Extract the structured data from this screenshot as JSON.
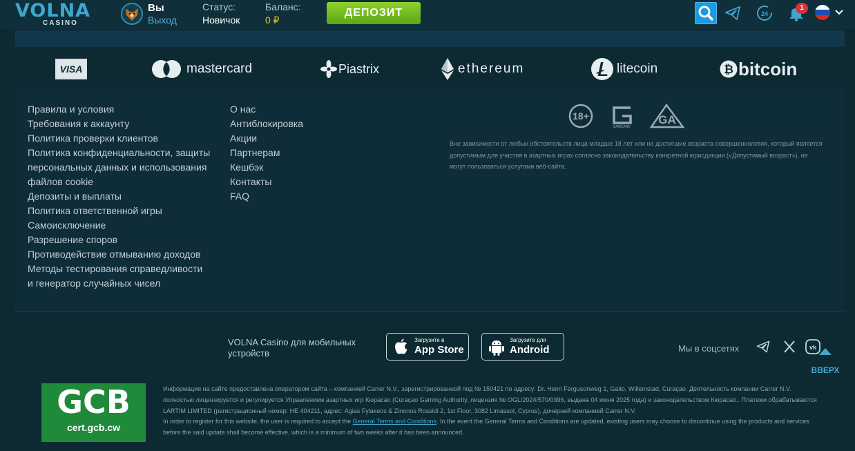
{
  "header": {
    "logo_word": "VOLNA",
    "logo_sub": "CASINO",
    "user_name": "Вы",
    "logout": "Выход",
    "status_label": "Статус:",
    "status_value": "Новичок",
    "balance_label": "Баланс:",
    "balance_value": "0 ₽",
    "deposit_label": "ДЕПОЗИТ",
    "notifications_count": "1",
    "support_label": "24",
    "icons": [
      "search-icon",
      "telegram-icon",
      "support-24-icon",
      "bell-icon",
      "russia-flag-icon",
      "chevron-down-icon"
    ]
  },
  "payments": {
    "visa": "VISA",
    "mastercard": "mastercard",
    "piastrix": "Piastrix",
    "ethereum": "ethereum",
    "litecoin": "litecoin",
    "bitcoin": "bitcoin"
  },
  "footer_links_left": [
    "Правила и условия",
    "Требования к аккаунту",
    "Политика проверки клиентов",
    "Политика конфиденциальности, защиты",
    "персональных данных и использования",
    "файлов cookie",
    "Депозиты и выплаты",
    "Политика ответственной игры",
    "Самоисключение",
    "Разрешение споров",
    "Противодействие отмыванию доходов",
    "Методы тестирования справедливости",
    "и генератор случайных чисел"
  ],
  "footer_links_right": [
    "О нас",
    "Антиблокировка",
    "Акции",
    "Партнерам",
    "Кешбэк",
    "Контакты",
    "FAQ"
  ],
  "badges": {
    "age": "18+",
    "gamcare": "GAMCARE",
    "ga": "GA"
  },
  "disclaimer": "Вне зависимости от любых обстоятельств лица младше 18 лет или не достигшие возраста совершеннолетия, который является допустимым для участия в азартных играх согласно законодательству конкретной юрисдикции («Допустимый возраст»), не могут пользоваться услугами веб-сайта.",
  "mobile": {
    "text": "VOLNA Casino для мобильных устройств",
    "appstore_small": "Загрузите в",
    "appstore_big": "App Store",
    "android_small": "Загрузите для",
    "android_big": "Android"
  },
  "social": {
    "label": "Мы в соцсетях",
    "icons": [
      "telegram-icon",
      "x-icon",
      "vk-icon"
    ]
  },
  "up_label": "ВВЕРХ",
  "gcb": {
    "title": "GCB",
    "site": "cert.gcb.cw"
  },
  "legal": {
    "p1": "Информация на сайте предоставлена оператором сайта – компанией Carrer N.V., зарегистрированной под № 150421 по адресу: Dr. Henri Fergusonweg 1, Gaito, Willemstad, Curaçao. Деятельность компании Carrer N.V. полностью лицензируется и регулируется Управлением азартных игр Кюрасао (Curaçao Gaming Authority, лицензия № OGL/2024/570/0396, выдана 04 июня 2025 года) и законодательством Кюрасао.. Платежи обрабатываются LARTIM LIMITED (регистрационный номер: HE 404211, адрес: Agias Fylaxeos & Zinonos Rossidi 2, 1st Floor, 3082 Limassol, Cyprus), дочерней компанией Carrer N.V.",
    "p2_before": "In order to register for this website, the user is required to accept the ",
    "p2_link": "General Terms and Conditions",
    "p2_after": ". In the event the General Terms and Conditions are updated, existing users may choose to discontinue using the products and services before the said update shall become effective, which is a minimum of two weeks after it has been announced."
  },
  "colors": {
    "background": "#0d2a33",
    "panel": "#0f2d38",
    "accent_blue": "#3fa6cf",
    "deposit_green": "#6fb81f",
    "balance_yellow": "#e4c21a",
    "badge_red": "#d9323a",
    "gcb_green": "#1e8a3a"
  }
}
